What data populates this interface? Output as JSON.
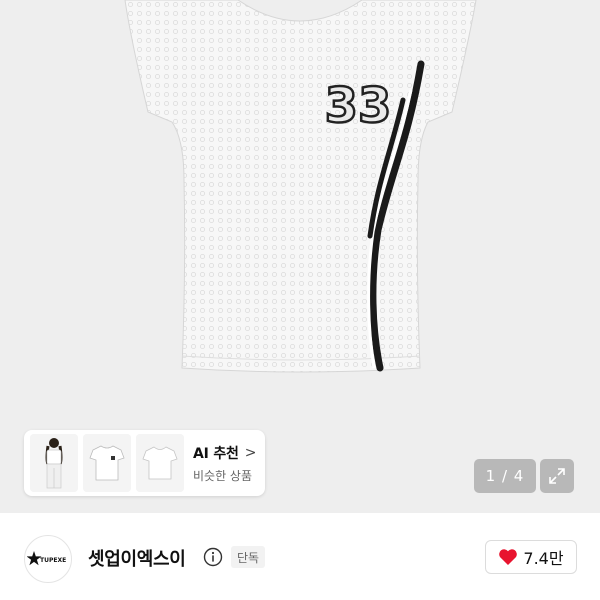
{
  "product_gallery": {
    "shirt_number": "33",
    "page_current": "1",
    "page_total": "4",
    "page_indicator": "1 / 4"
  },
  "ai_recommend": {
    "title": "AI 추천",
    "subtitle": "비슷한 상품",
    "thumbnails": [
      "model-wearing-shirt",
      "grey-tshirt",
      "white-tshirt"
    ]
  },
  "seller": {
    "brand_name": "셋업이엑스이",
    "logo_text": "TUPEXE",
    "exclusive_label": "단독",
    "like_count": "7.4만"
  },
  "colors": {
    "background": "#eeeeee",
    "heart": "#e8142f",
    "stripe": "#1a1a1a"
  },
  "icons": {
    "info": "info-icon",
    "heart": "heart-icon",
    "expand": "expand-icon",
    "chevron": "chevron-right-icon"
  }
}
